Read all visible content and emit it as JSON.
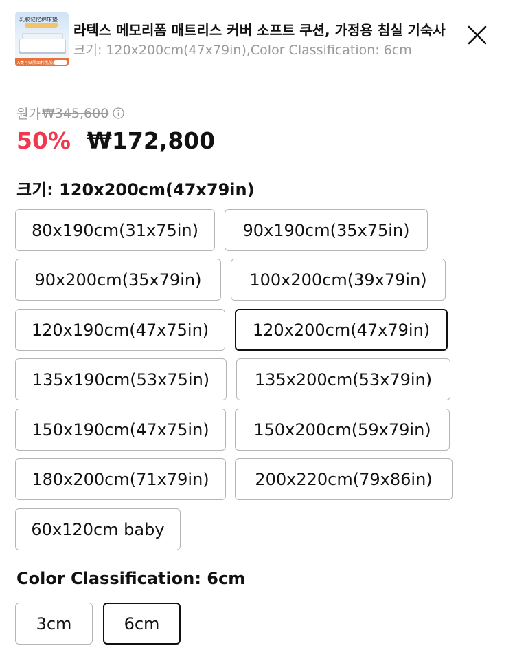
{
  "header": {
    "thumbnail": {
      "caption_top": "乳胶记忆棉床垫",
      "caption_bottom": "A类可贴肌面料乳胶床垫"
    },
    "title": "라텍스 메모리폼 매트리스 커버 소프트 쿠션, 가정용 침실 기숙사",
    "subtitle": "크기: 120x200cm(47x79in),Color Classification: 6cm",
    "close_icon": "close-icon"
  },
  "pricing": {
    "original_label": "원가",
    "original_price": "₩345,600",
    "info_icon": "info-icon",
    "discount": "50%",
    "price": "₩172,800",
    "accent_color": "#f0394f"
  },
  "size_section": {
    "title": "크기: 120x200cm(47x79in)",
    "options": [
      {
        "label": "80x190cm(31x75in)",
        "selected": false
      },
      {
        "label": "90x190cm(35x75in)",
        "selected": false
      },
      {
        "label": "90x200cm(35x79in)",
        "selected": false
      },
      {
        "label": "100x200cm(39x79in)",
        "selected": false
      },
      {
        "label": "120x190cm(47x75in)",
        "selected": false
      },
      {
        "label": "120x200cm(47x79in)",
        "selected": true
      },
      {
        "label": "135x190cm(53x75in)",
        "selected": false
      },
      {
        "label": "135x200cm(53x79in)",
        "selected": false
      },
      {
        "label": "150x190cm(47x75in)",
        "selected": false
      },
      {
        "label": "150x200cm(59x79in)",
        "selected": false
      },
      {
        "label": "180x200cm(71x79in)",
        "selected": false
      },
      {
        "label": "200x220cm(79x86in)",
        "selected": false
      },
      {
        "label": "60x120cm baby",
        "selected": false
      }
    ]
  },
  "color_section": {
    "title": "Color Classification: 6cm",
    "options": [
      {
        "label": "3cm",
        "selected": false
      },
      {
        "label": "6cm",
        "selected": true
      }
    ]
  }
}
